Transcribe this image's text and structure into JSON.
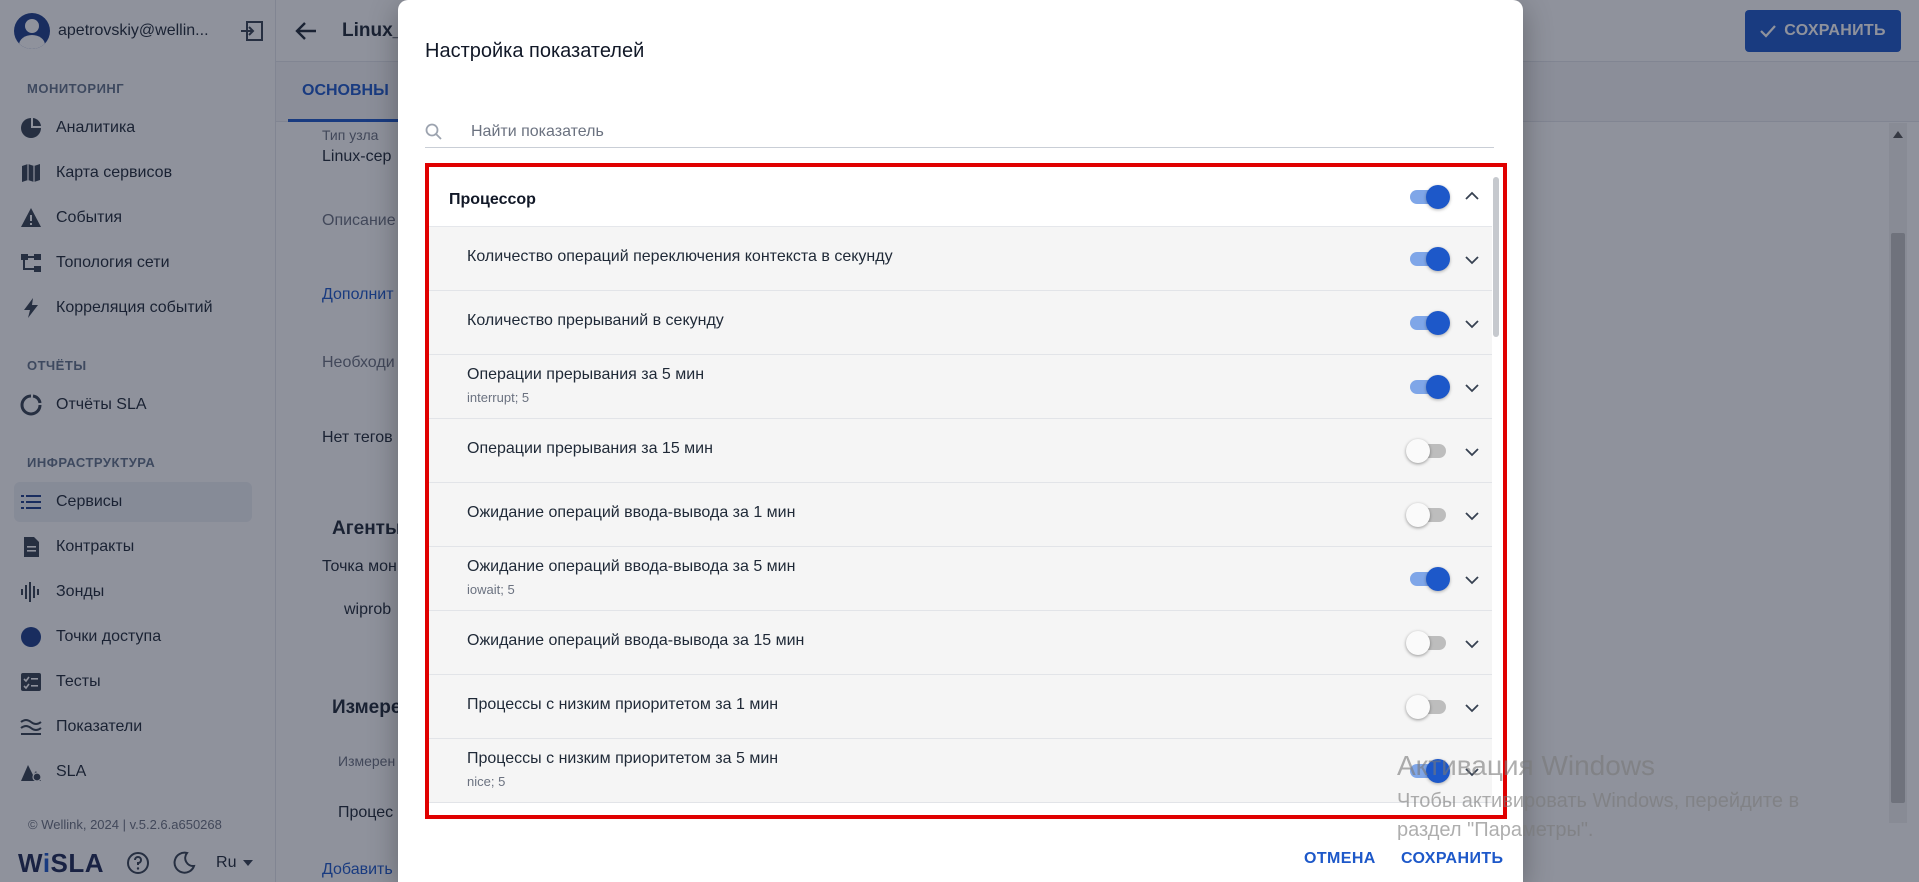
{
  "sidebar": {
    "user_email": "apetrovskiy@wellin...",
    "sections": [
      {
        "title": "МОНИТОРИНГ"
      },
      {
        "title": "ОТЧЁТЫ"
      },
      {
        "title": "ИНФРАСТРУКТУРА"
      }
    ],
    "items": [
      {
        "label": "Аналитика",
        "icon": "pie-chart-icon"
      },
      {
        "label": "Карта сервисов",
        "icon": "map-icon"
      },
      {
        "label": "События",
        "icon": "warning-icon"
      },
      {
        "label": "Топология сети",
        "icon": "topology-icon"
      },
      {
        "label": "Корреляция событий",
        "icon": "bolt-icon"
      },
      {
        "label": "Отчёты SLA",
        "icon": "report-icon"
      },
      {
        "label": "Сервисы",
        "icon": "list-icon",
        "active": true
      },
      {
        "label": "Контракты",
        "icon": "document-icon"
      },
      {
        "label": "Зонды",
        "icon": "probe-icon"
      },
      {
        "label": "Точки доступа",
        "icon": "circle-icon"
      },
      {
        "label": "Тесты",
        "icon": "checklist-icon"
      },
      {
        "label": "Показатели",
        "icon": "waves-icon"
      },
      {
        "label": "SLA",
        "icon": "sla-icon"
      }
    ],
    "copyright": "© Wellink, 2024 | v.5.2.6.a650268",
    "logo_prefix": "W",
    "logo_i": "i",
    "logo_suffix": "SLA",
    "language": "Ru"
  },
  "main": {
    "title": "Linux_s",
    "save_label": "СОХРАНИТЬ",
    "tab_main": "ОСНОВНЫ",
    "node_type_label": "Тип узла",
    "node_type_value": "Linux-сер",
    "description_label": "Описание",
    "additional_link": "Дополнит",
    "required_label": "Необходи",
    "no_tags": "Нет тегов",
    "agents_heading": "Агенты",
    "monitoring_point": "Точка мон",
    "probe_value": "wiprob",
    "measurements_heading": "Измере",
    "measurement_col": "Измерен",
    "process_value": "Процес",
    "add_link": "Добавить"
  },
  "dialog": {
    "title": "Настройка показателей",
    "search_placeholder": "Найти показатель",
    "group_title": "Процессор",
    "group_enabled": true,
    "rows": [
      {
        "label": "Количество операций переключения контекста в секунду",
        "sub": "",
        "enabled": true
      },
      {
        "label": "Количество прерываний в секунду",
        "sub": "",
        "enabled": true
      },
      {
        "label": "Операции прерывания за 5 мин",
        "sub": "interrupt; 5",
        "enabled": true
      },
      {
        "label": "Операции прерывания за 15 мин",
        "sub": "",
        "enabled": false
      },
      {
        "label": "Ожидание операций ввода-вывода за 1 мин",
        "sub": "",
        "enabled": false
      },
      {
        "label": "Ожидание операций ввода-вывода за 5 мин",
        "sub": "iowait; 5",
        "enabled": true
      },
      {
        "label": "Ожидание операций ввода-вывода за 15 мин",
        "sub": "",
        "enabled": false
      },
      {
        "label": "Процессы с низким приоритетом за 1 мин",
        "sub": "",
        "enabled": false
      },
      {
        "label": "Процессы с низким приоритетом за 5 мин",
        "sub": "nice; 5",
        "enabled": true
      }
    ],
    "cancel_label": "ОТМЕНА",
    "save_label": "СОХРАНИТЬ"
  },
  "watermark": {
    "title": "Активация Windows",
    "line1": "Чтобы активировать Windows, перейдите в",
    "line2": "раздел \"Параметры\"."
  },
  "colors": {
    "accent": "#1d58c9",
    "highlight_frame": "#e00000"
  }
}
